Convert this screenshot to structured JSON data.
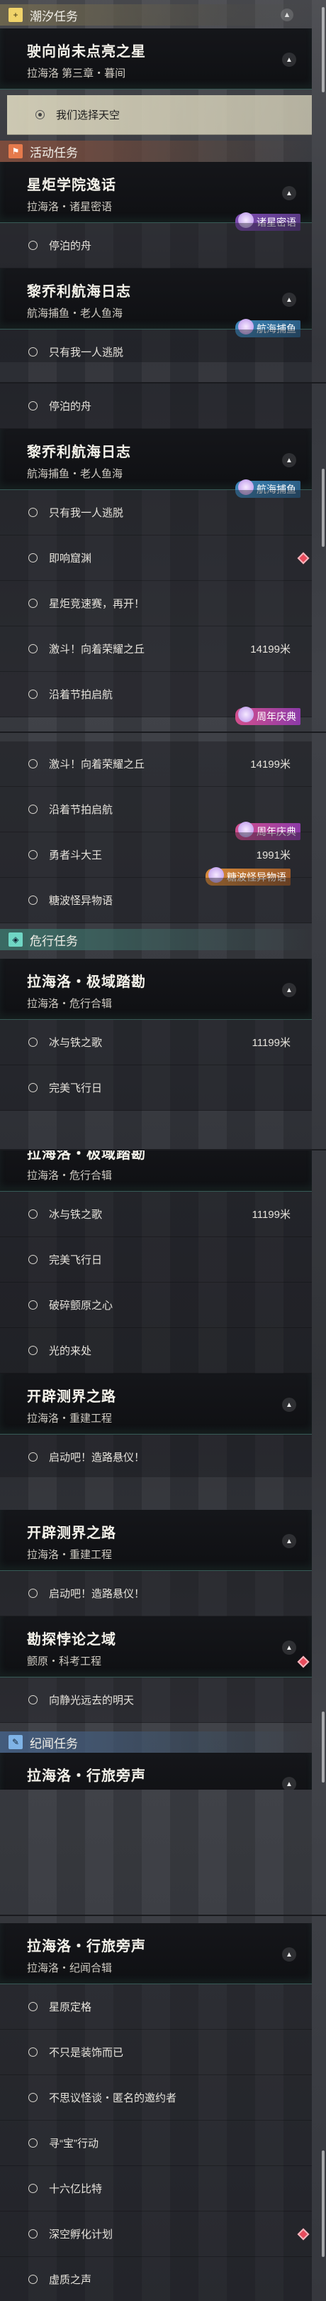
{
  "sections": {
    "chaoxi": "潮汐任务",
    "huodong": "活动任务",
    "weixing": "危行任务",
    "jiwen": "纪闻任务"
  },
  "icons": {
    "chaoxi": "plus-icon",
    "huodong": "activity-icon",
    "weixing": "hazard-icon",
    "jiwen": "chronicle-icon"
  },
  "quests": {
    "q1": {
      "title": "驶向尚未点亮之星",
      "sub": "拉海洛 第三章・暮间"
    },
    "q2": {
      "title": "星炬学院逸话",
      "sub": "拉海洛・诸星密语"
    },
    "q3": {
      "title": "黎乔利航海日志",
      "sub": "航海捕鱼・老人鱼海"
    },
    "q4": {
      "title": "拉海洛・极域踏勘",
      "sub": "拉海洛・危行合辑"
    },
    "q5": {
      "title": "开辟测界之路",
      "sub": "拉海洛・重建工程"
    },
    "q6": {
      "title": "勘探悖论之域",
      "sub": "颤原・科考工程"
    },
    "q7": {
      "title": "拉海洛・行旅旁声",
      "sub": "拉海洛・纪闻合辑"
    }
  },
  "items": {
    "select_sky": "我们选择天空",
    "boat": "停泊的舟",
    "one_only": "只有我一人逃脱",
    "mirage": "即响窟渊",
    "star_race": "星炬竞速赛，再开！",
    "rush": "激斗！向着荣耀之丘",
    "rush_dist": "14199米",
    "rhythm": "沿着节拍启航",
    "brave": "勇者斗大王",
    "brave_dist": "1991米",
    "candy": "糖波怪异物语",
    "ice": "冰与铁之歌",
    "ice_dist": "11199米",
    "perfect": "完美飞行日",
    "broken": "破碎颤原之心",
    "light": "光的来处",
    "start": "启动吧！造路悬仪！",
    "chase": "向静光远去的明天",
    "star_map": "星原定格",
    "beauty": "不只是装饰而已",
    "nothink": "不思议怪谈・匿名的邀约者",
    "treasure": "寻“宝”行动",
    "billion": "十六亿比特",
    "deep": "深空孵化计划",
    "fake": "虚质之声"
  },
  "tags": {
    "zhuxing": "诸星密语",
    "hanghai": "航海捕鱼",
    "zhounian": "周年庆典",
    "tangbo": "糖波怪异物语",
    "half": "航海捕鱼",
    "half2": "周年庆典"
  },
  "colors": {
    "accent": "#6fd6c4",
    "gold": "#f0d36a",
    "red": "#e57a4c",
    "diamond": "#e84b5c"
  }
}
